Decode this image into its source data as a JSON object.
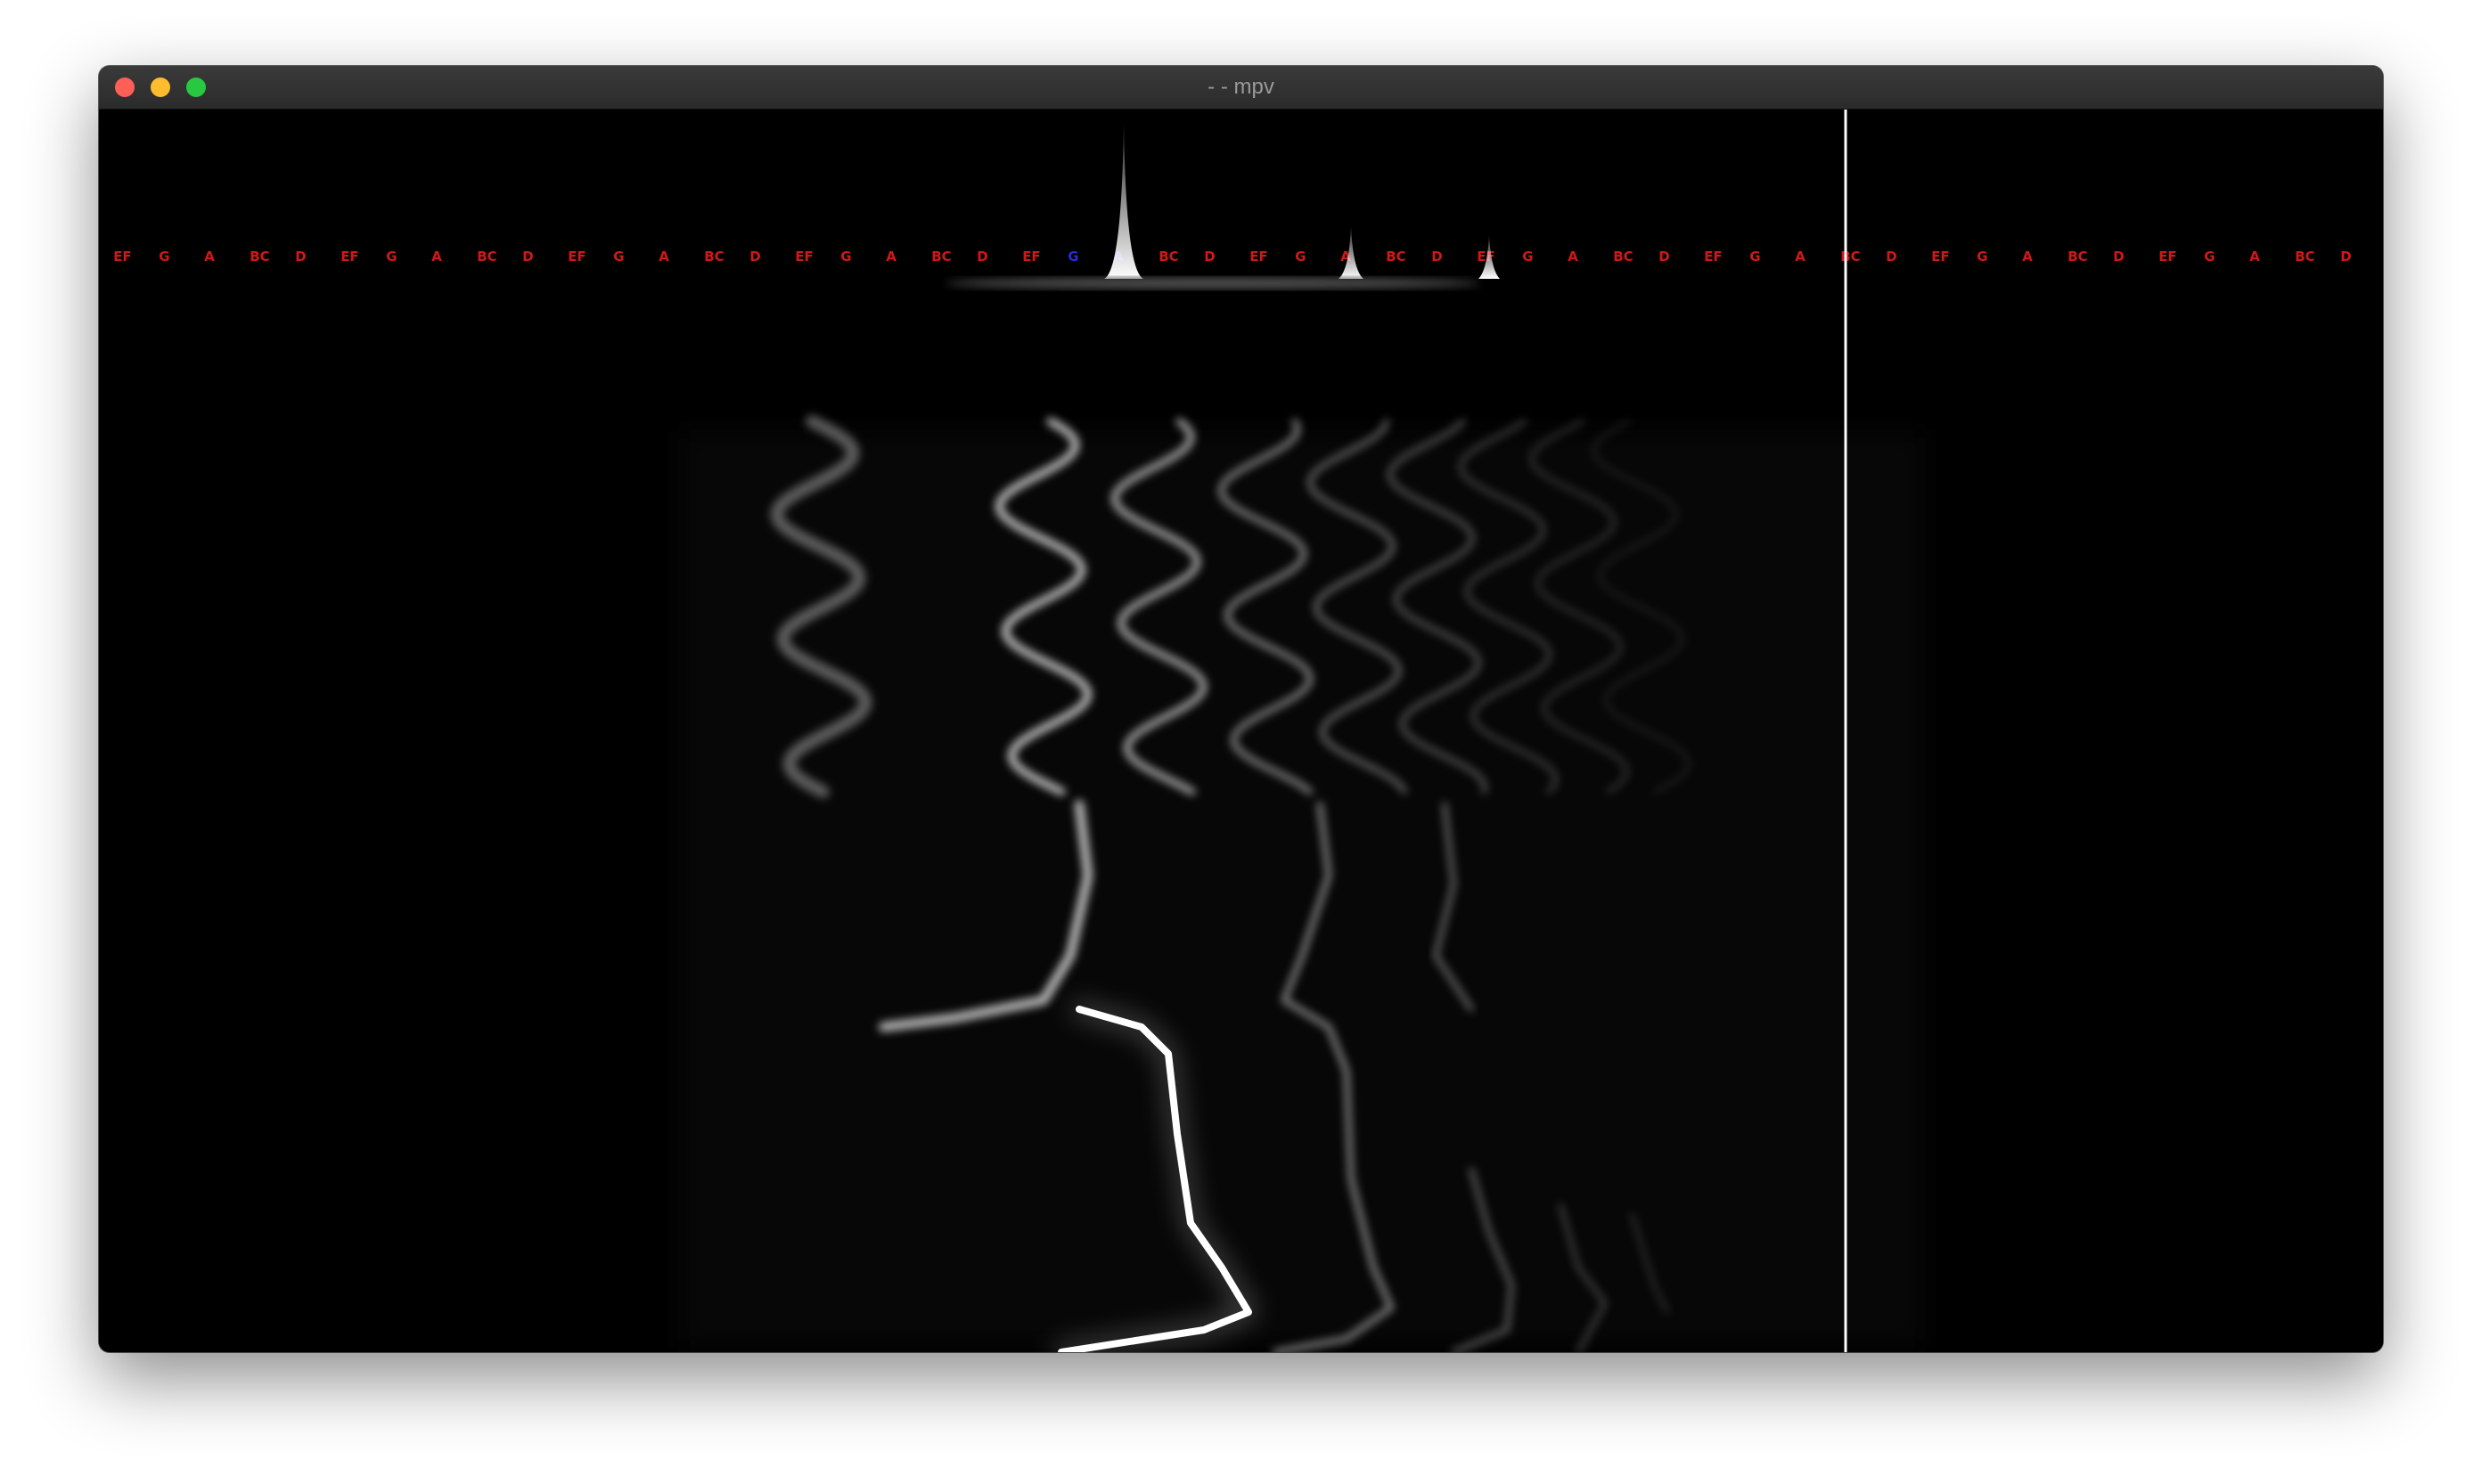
{
  "window": {
    "title": "- - mpv"
  },
  "colors": {
    "close": "#ff5f57",
    "minimize": "#febc2e",
    "zoom": "#28c840",
    "note_default": "#d01818",
    "note_active": "#2a2ad8",
    "background": "#000000",
    "playhead": "#ffffff"
  },
  "visualizer": {
    "type": "spectrogram-with-piano-note-labels",
    "note_labels": [
      "EF",
      "G",
      "A",
      "BC",
      "D",
      "EF",
      "G",
      "A",
      "BC",
      "D",
      "EF",
      "G",
      "A",
      "BC",
      "D",
      "EF",
      "G",
      "A",
      "BC",
      "D",
      "EF",
      "G",
      "A",
      "BC",
      "D",
      "EF",
      "G",
      "A",
      "BC",
      "D",
      "EF",
      "G",
      "A",
      "BC",
      "D",
      "EF",
      "G",
      "A",
      "BC",
      "D",
      "EF",
      "G",
      "A",
      "BC",
      "D",
      "EF",
      "G",
      "A",
      "BC",
      "D"
    ],
    "active_note_labels": [
      21,
      22
    ]
  }
}
